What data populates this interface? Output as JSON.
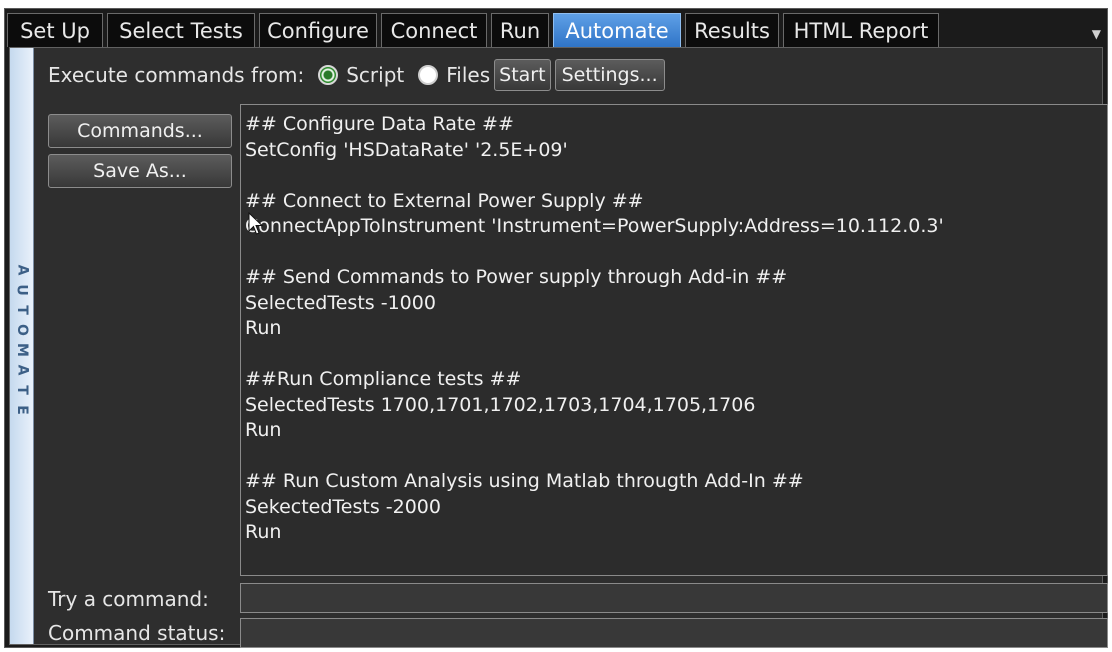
{
  "tabs": [
    {
      "label": "Set Up",
      "active": false
    },
    {
      "label": "Select Tests",
      "active": false
    },
    {
      "label": "Configure",
      "active": false
    },
    {
      "label": "Connect",
      "active": false
    },
    {
      "label": "Run",
      "active": false
    },
    {
      "label": "Automate",
      "active": true
    },
    {
      "label": "Results",
      "active": false
    },
    {
      "label": "HTML Report",
      "active": false
    }
  ],
  "sidebar": {
    "letters": [
      "A",
      "U",
      "T",
      "O",
      "M",
      "A",
      "T",
      "E"
    ]
  },
  "execute": {
    "label": "Execute commands from:",
    "script_label": "Script",
    "files_label": "Files",
    "selected": "Script",
    "start_label": "Start",
    "settings_label": "Settings..."
  },
  "buttons": {
    "commands_label": "Commands...",
    "save_as_label": "Save As..."
  },
  "script": {
    "lines": [
      "## Configure Data Rate ##",
      "SetConfig 'HSDataRate' '2.5E+09'",
      "",
      "## Connect to External Power Supply ##",
      "ConnectAppToInstrument 'Instrument=PowerSupply:Address=10.112.0.3'",
      "",
      "## Send Commands to Power supply through Add-in ##",
      "SelectedTests -1000",
      "Run",
      "",
      "##Run Compliance tests ##",
      "SelectedTests 1700,1701,1702,1703,1704,1705,1706",
      "Run",
      "",
      "## Run Custom Analysis using Matlab througth Add-In ##",
      "SekectedTests -2000",
      "Run"
    ]
  },
  "try_command": {
    "label": "Try a command:",
    "value": ""
  },
  "command_status": {
    "label": "Command status:",
    "value": ""
  },
  "colors": {
    "accent_tab": "#3a82d6",
    "panel_bg": "#2e2e2e",
    "sidebar_bg": "#d6e4f4",
    "radio_selected": "#2a8a2a"
  },
  "icons": {
    "radio_on": "radio-selected-icon",
    "radio_off": "radio-unselected-icon",
    "overflow": "chevron-down-icon",
    "pointer": "mouse-pointer-icon"
  }
}
